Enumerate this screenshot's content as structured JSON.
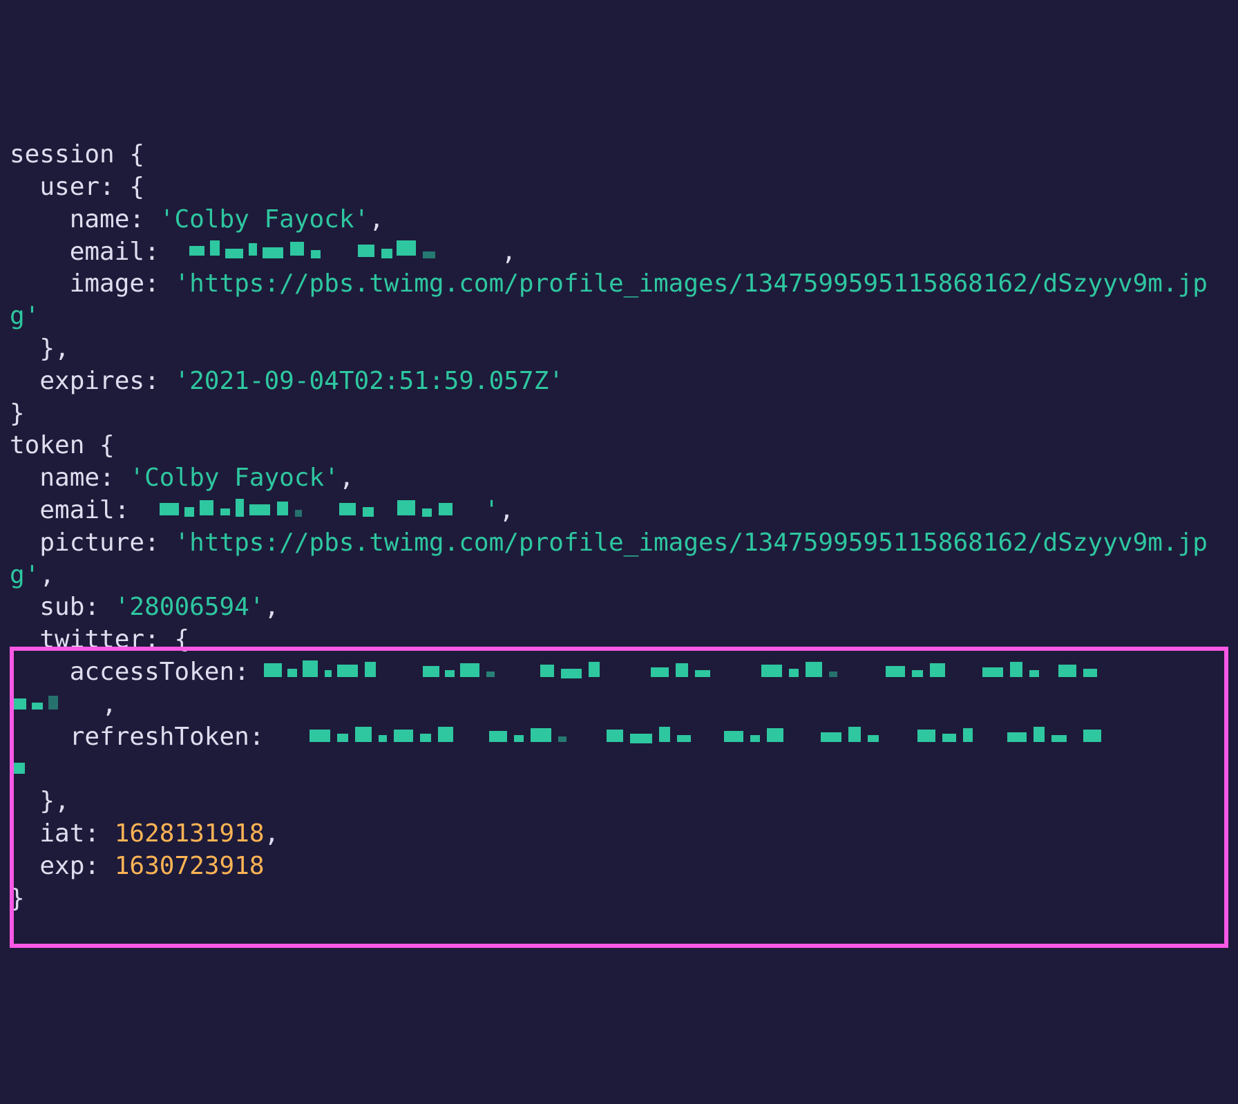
{
  "session": {
    "label": "session",
    "user_label": "user",
    "user": {
      "name_key": "name",
      "name_value": "'Colby Fayock'",
      "email_key": "email",
      "email_redacted": true,
      "image_key": "image",
      "image_value": "'https://pbs.twimg.com/profile_images/1347599595115868162/dSzyyv9m.jpg'"
    },
    "expires_key": "expires",
    "expires_value": "'2021-09-04T02:51:59.057Z'"
  },
  "token": {
    "label": "token",
    "name_key": "name",
    "name_value": "'Colby Fayock'",
    "email_key": "email",
    "email_redacted": true,
    "picture_key": "picture",
    "picture_value": "'https://pbs.twimg.com/profile_images/1347599595115868162/dSzyyv9m.jpg'",
    "sub_key": "sub",
    "sub_value": "'28006594'",
    "twitter_key": "twitter",
    "twitter": {
      "accessToken_key": "accessToken",
      "accessToken_redacted": true,
      "refreshToken_key": "refreshToken",
      "refreshToken_redacted": true
    },
    "iat_key": "iat",
    "iat_value": "1628131918",
    "exp_key": "exp",
    "exp_value": "1630723918"
  }
}
